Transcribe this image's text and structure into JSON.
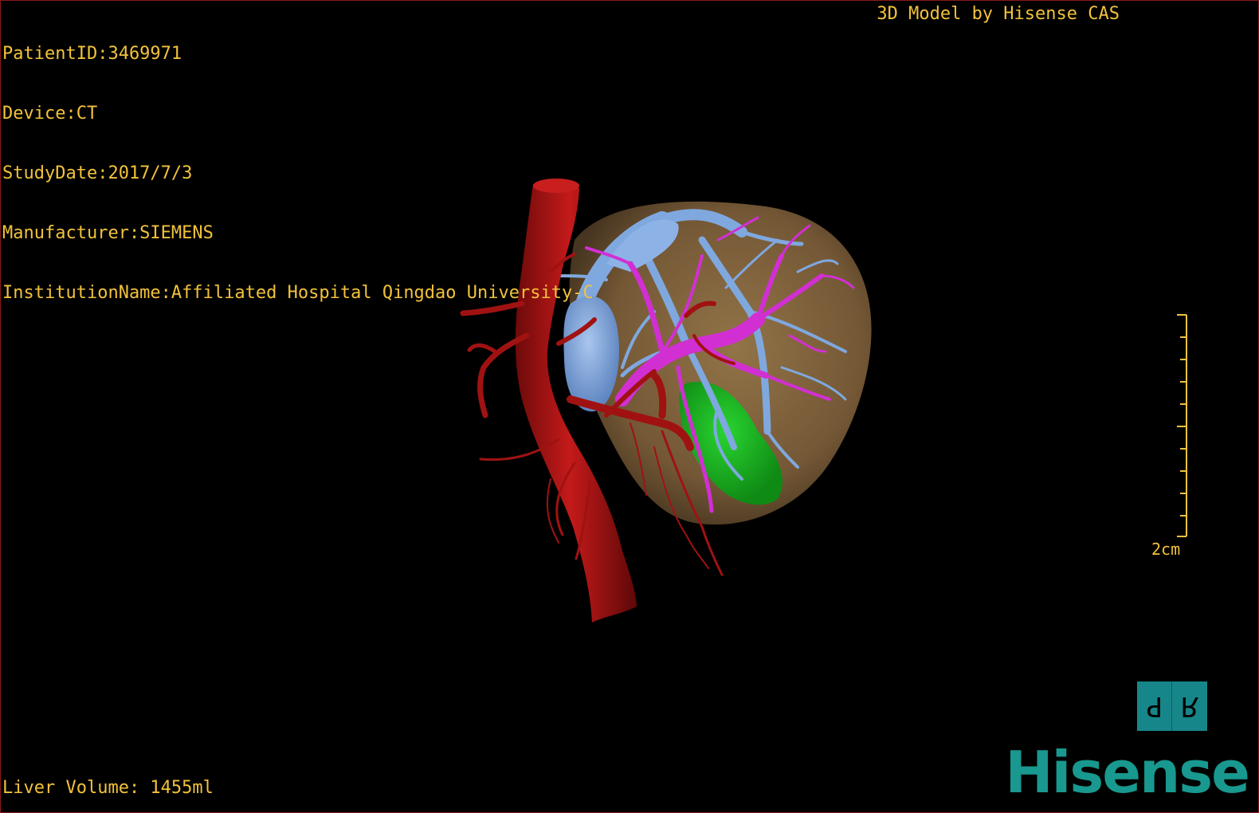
{
  "header": {
    "patient_id": "PatientID:3469971",
    "device": "Device:CT",
    "study_date": "StudyDate:2017/7/3",
    "manufacturer": "Manufacturer:SIEMENS",
    "institution": "InstitutionName:Affiliated Hospital Qingdao University-C"
  },
  "brand_line": "3D Model by Hisense CAS",
  "footer": {
    "liver_volume": "Liver Volume: 1455ml"
  },
  "scale": {
    "label": "2cm"
  },
  "orientation": {
    "left_face": "P",
    "right_face": "R"
  },
  "logo": {
    "text": "Hisense"
  },
  "colors": {
    "overlay_text": "#f2c23b",
    "artery": "#b01515",
    "portal_vein": "#d22fd3",
    "hepatic_vein": "#7fa8df",
    "liver": "#8a6c44",
    "tumor": "#17b81e",
    "brand": "#18988f"
  }
}
